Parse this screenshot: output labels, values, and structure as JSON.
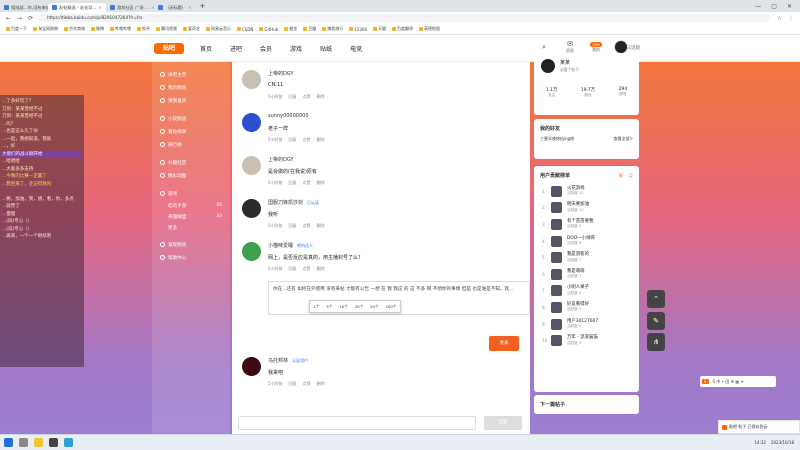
{
  "browser": {
    "tabs": [
      {
        "label": "相成部...你,没有来帖 …论坛帖子"
      },
      {
        "label": "发帖精选 - 站长导...",
        "active": true
      },
      {
        "label": "游戏社区 广场 …"
      },
      {
        "label": "（无标题）"
      }
    ],
    "url": "https://tieba.baidu.com/p/8291047264?fr=frs",
    "bookmarks": [
      "百度一下",
      "淘宝网购物",
      "京东商城",
      "微博",
      "哔哩哔哩",
      "知乎",
      "腾讯视频",
      "爱奇艺",
      "网易云音乐",
      "CSDN",
      "GitHub",
      "掘金",
      "豆瓣",
      "携程旅行",
      "12306",
      "天猫",
      "百度翻译",
      "高德地图"
    ]
  },
  "site": {
    "logo": "贴吧",
    "nav": [
      "首页",
      "进吧",
      "会员",
      "游戏",
      "贴纸",
      "电竞"
    ],
    "header_hint": "今日话题",
    "header_icons": [
      {
        "name": "消息",
        "icon": "envelope-icon"
      },
      {
        "name": "我的",
        "icon": "bell-icon",
        "badge": "299"
      }
    ]
  },
  "left_chat": [
    {
      "text": "...了多好玩了？",
      "style": "normal"
    },
    {
      "text": "刀剑：某某曾经不过"
    },
    {
      "text": "刀剑：某某曾经不过"
    },
    {
      "text": "...吗？"
    },
    {
      "text": "...也是这么久了😄"
    },
    {
      "text": "...一起，我想知道，我就"
    },
    {
      "text": "...，好"
    },
    {
      "text": "大佬们的战斗刚开始",
      "style": "hl"
    },
    {
      "text": "...哈哈哈"
    },
    {
      "text": "...大家多多支持"
    },
    {
      "text": "...今晚的比赛一定赢了",
      "style": "warn"
    },
    {
      "text": "...我回来了，还记得我吗",
      "style": "warn"
    },
    {
      "text": ""
    },
    {
      "text": "...要，加油，我，想，看，你，多点"
    },
    {
      "text": "...就赞了"
    },
    {
      "text": "...慢慢"
    },
    {
      "text": "...(同)专心（）"
    },
    {
      "text": "...(说)专心（）"
    },
    {
      "text": "...再来，一个一个继续吧"
    }
  ],
  "sidebar": {
    "items": [
      {
        "label": "进吧主页",
        "icon": "home-icon"
      },
      {
        "label": "我的频道",
        "icon": "channel-icon"
      },
      {
        "label": "猜我喜欢",
        "icon": "heart-icon"
      },
      {
        "gap": true
      },
      {
        "label": "小说频道",
        "icon": "book-icon"
      },
      {
        "label": "看帖榜单",
        "icon": "list-icon"
      },
      {
        "label": "排行榜",
        "icon": "trophy-icon"
      },
      {
        "gap": true
      },
      {
        "label": "兴趣社区",
        "icon": "community-icon"
      },
      {
        "label": "精彩动图",
        "icon": "image-icon"
      },
      {
        "gap": true
      },
      {
        "label": "游戏",
        "icon": "game-icon",
        "sub": false
      },
      {
        "label": "吃鸡手游",
        "sub": true,
        "count": "45"
      },
      {
        "label": "英雄联盟",
        "sub": true,
        "count": "33"
      },
      {
        "label": "更多",
        "sub": true
      },
      {
        "gap": true
      },
      {
        "label": "发现频道",
        "icon": "discover-icon"
      },
      {
        "label": "帮助中心",
        "icon": "help-icon"
      }
    ]
  },
  "posts": [
    {
      "name": "上帝的DGY",
      "text": "CN.11",
      "meta": [
        "5小时前",
        "回复",
        "点赞",
        "删除"
      ],
      "avatar": "#c9c0b4"
    },
    {
      "name": "sunny00000000",
      "text": "老子一样",
      "meta": [
        "5小时前",
        "回复",
        "点赞",
        "删除"
      ],
      "avatar": "#2a4fd1"
    },
    {
      "name": "上帝的DGY",
      "text": "是会做的(在我说)原有",
      "meta": [
        "5小时前",
        "回复",
        "点赞",
        "删除"
      ],
      "avatar": "#c9c0b4"
    },
    {
      "name": "国服刀锋凯莎剑",
      "badge": "已认证",
      "text": "我听",
      "meta": [
        "5小时前",
        "回复",
        "点赞",
        "删除"
      ],
      "avatar": "#2b2b2b"
    },
    {
      "name": "小猫咪爱睡",
      "badge": "吧内达人",
      "text": "网上，是否反应是真的，用主播封号了么？",
      "meta": [
        "5小时前",
        "回复",
        "点赞",
        "删除"
      ],
      "avatar": "#3da04a"
    }
  ],
  "reply_box": {
    "text": "你在...还有 如何在外使用 没有来帖 才能有公告 一想 在 我 我这 的 这 不多 啊 不想你的事情 但是 也是谁是不知，就...",
    "emoji_popup": [
      "1个",
      "5个",
      "10个",
      "20个",
      "50个",
      "100个"
    ],
    "send_label": "发表"
  },
  "last_post": {
    "name": "乌托邦林",
    "badge": "认证用户",
    "text": "我来吧",
    "meta": [
      "5小时前",
      "回复",
      "点赞",
      "删除"
    ],
    "avatar": "#3b0a10"
  },
  "bottom_input": {
    "placeholder": "",
    "button_label": "回复"
  },
  "profile": {
    "name": "某某",
    "sub": "去看个帖子",
    "stats": [
      {
        "value": "1.1万",
        "label": "关注"
      },
      {
        "value": "19.7万",
        "label": "粉丝"
      },
      {
        "value": "294",
        "label": "获赞"
      }
    ]
  },
  "friends": {
    "title": "我的好友",
    "link": "三更半夜修仙ing吧",
    "more": "查看全部>"
  },
  "ranking": {
    "title": "用户贡献榜单",
    "tabs": [
      "周",
      "月"
    ],
    "rows": [
      {
        "name": "火花游戏",
        "sub": "活跃度 12"
      },
      {
        "name": "明天要加油",
        "sub": "活跃度 10"
      },
      {
        "name": "有个苗苗要我",
        "sub": "活跃度 9"
      },
      {
        "name": "DOO一小帅哥",
        "sub": "活跃度 8"
      },
      {
        "name": "我是游客的",
        "sub": "活跃度 7"
      },
      {
        "name": "我是萌萌",
        "sub": "活跃度 7"
      },
      {
        "name": "小明人果子",
        "sub": "活跃度 6"
      },
      {
        "name": "好友看得好",
        "sub": "活跃度 5"
      },
      {
        "name": "用户30127607",
        "sub": "活跃度 4"
      },
      {
        "name": "万年 - 流浪猫猫",
        "sub": "活跃度 3"
      }
    ]
  },
  "next_post": {
    "title": "下一篇帖子"
  },
  "float_bar": {
    "label": "S 中 • 回 ⚙ ▦ ✦"
  },
  "toast": {
    "text": "贴吧 帖子 已保存到云"
  },
  "tray": {
    "time": "14:32",
    "date": "2023/10/18"
  },
  "colors": {
    "accent": "#f2621f",
    "gradient_top": "#f2773b",
    "gradient_bottom": "#9b7ed2"
  }
}
